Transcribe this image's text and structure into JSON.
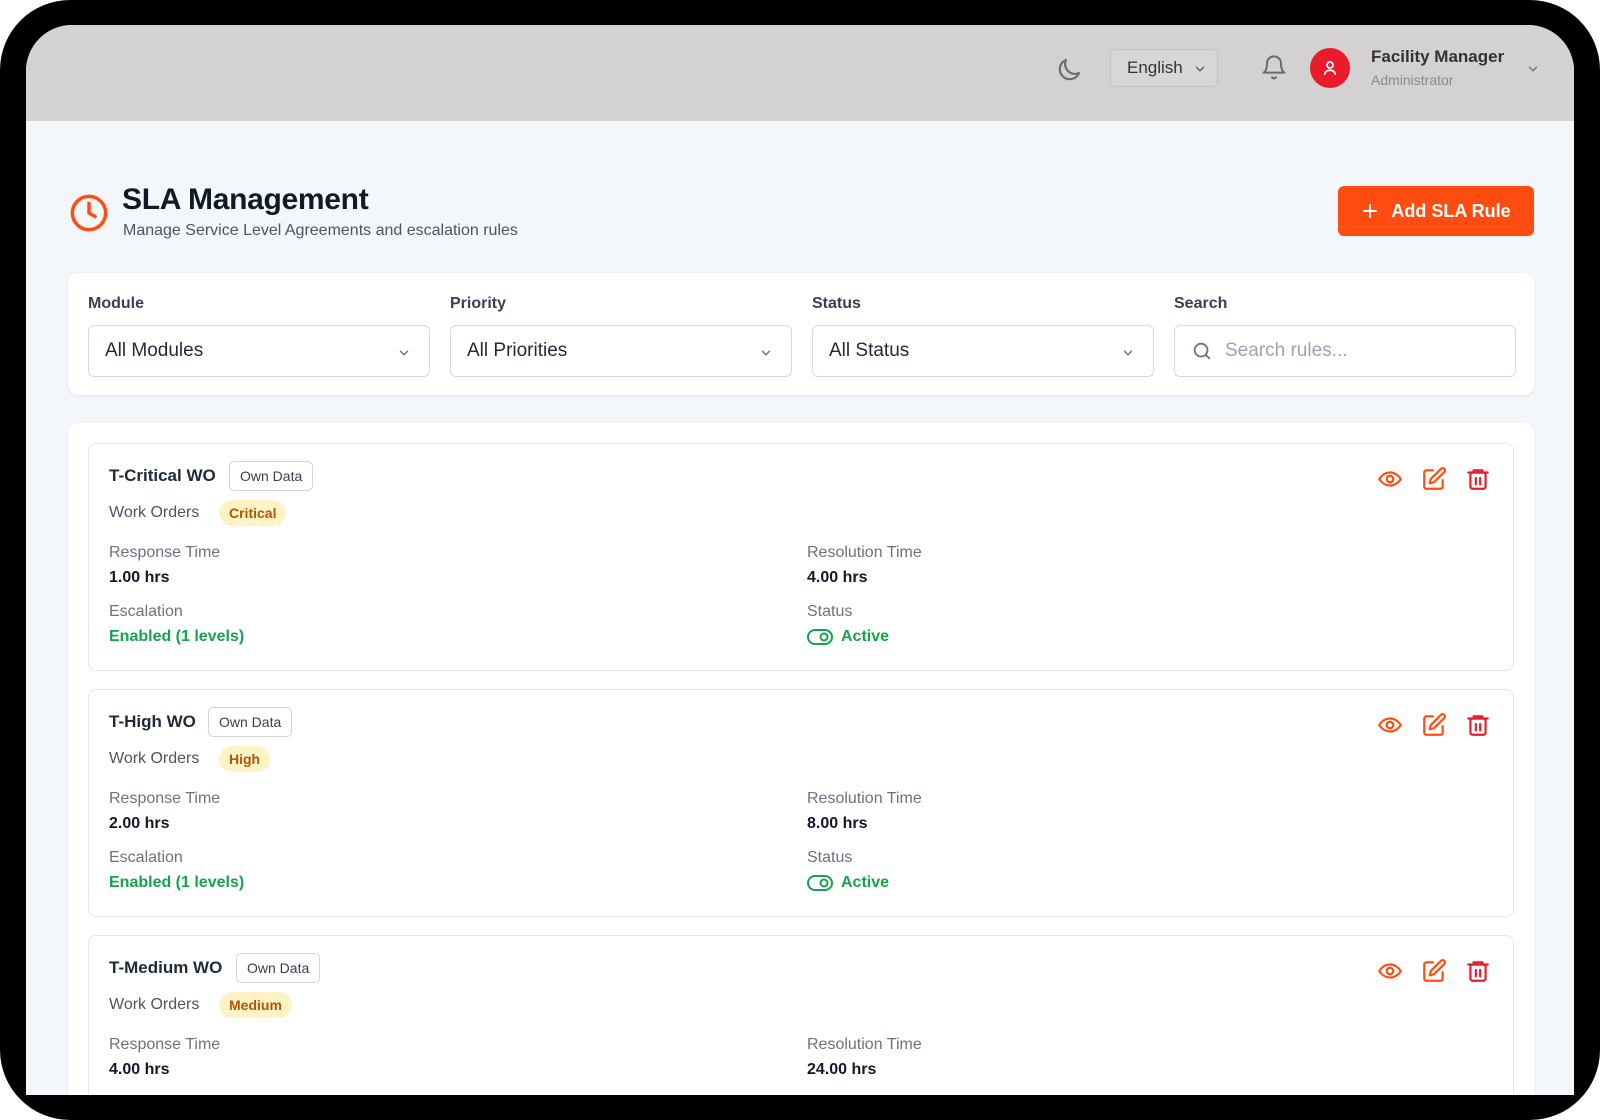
{
  "header": {
    "language": "English",
    "user_name": "Facility Manager",
    "user_role": "Administrator"
  },
  "page": {
    "title": "SLA Management",
    "subtitle": "Manage Service Level Agreements and escalation rules",
    "add_button": "Add SLA Rule"
  },
  "filters": {
    "module_label": "Module",
    "module_value": "All Modules",
    "priority_label": "Priority",
    "priority_value": "All Priorities",
    "status_label": "Status",
    "status_value": "All Status",
    "search_label": "Search",
    "search_placeholder": "Search rules..."
  },
  "labels": {
    "response_time": "Response Time",
    "resolution_time": "Resolution Time",
    "escalation": "Escalation",
    "status": "Status"
  },
  "rules": [
    {
      "name": "T-Critical WO",
      "scope": "Own Data",
      "module": "Work Orders",
      "priority": "Critical",
      "response_time": "1.00 hrs",
      "resolution_time": "4.00 hrs",
      "escalation": "Enabled (1 levels)",
      "status": "Active"
    },
    {
      "name": "T-High WO",
      "scope": "Own Data",
      "module": "Work Orders",
      "priority": "High",
      "response_time": "2.00 hrs",
      "resolution_time": "8.00 hrs",
      "escalation": "Enabled (1 levels)",
      "status": "Active"
    },
    {
      "name": "T-Medium WO",
      "scope": "Own Data",
      "module": "Work Orders",
      "priority": "Medium",
      "response_time": "4.00 hrs",
      "resolution_time": "24.00 hrs"
    }
  ],
  "colors": {
    "accent": "#ff4d12",
    "success": "#16a34a",
    "header_bg": "#d3d1d1",
    "avatar": "#ea1b2a"
  }
}
